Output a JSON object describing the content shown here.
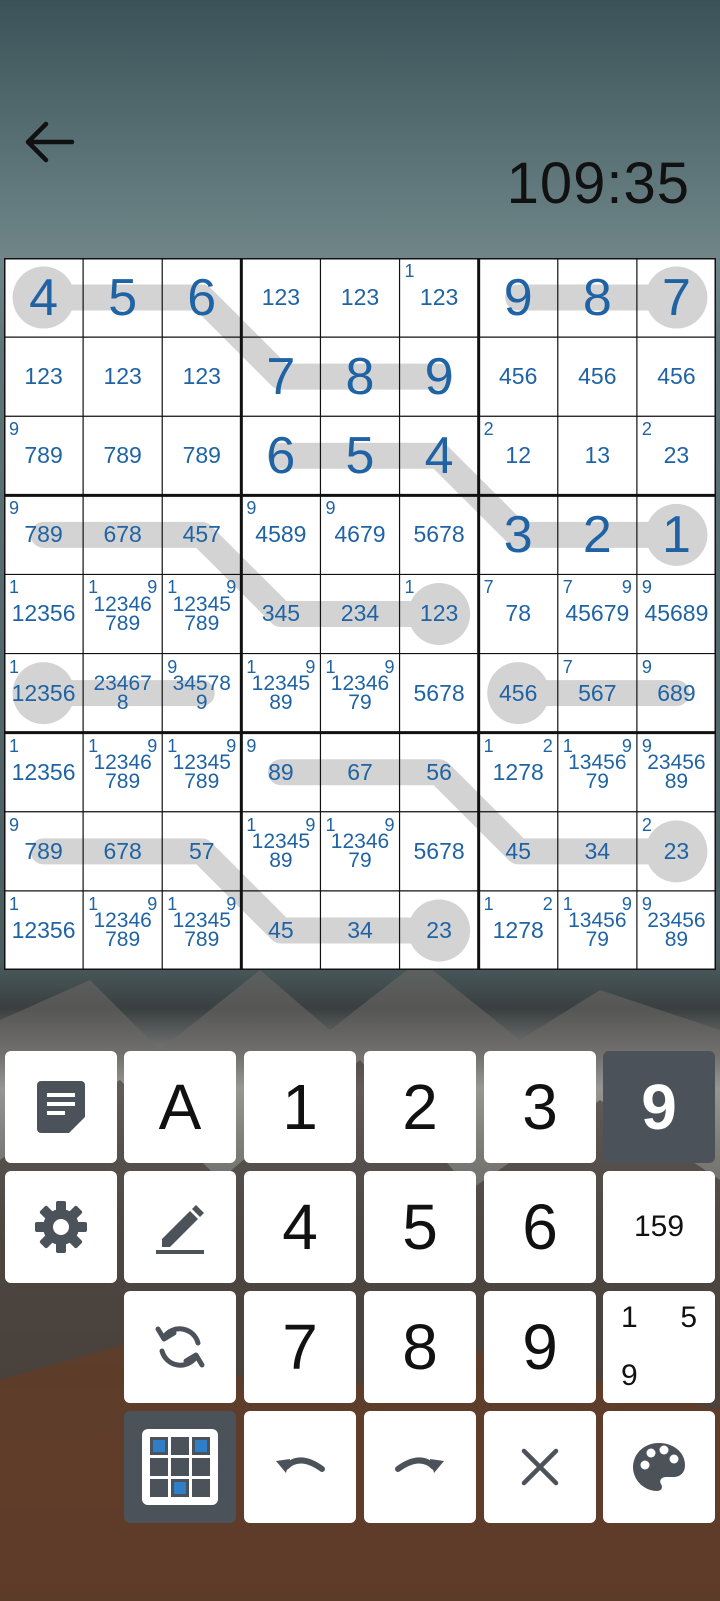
{
  "header": {
    "timer": "109:35",
    "back_icon": "arrow-left-icon"
  },
  "board": {
    "cells": [
      [
        {
          "v": "4"
        },
        {
          "v": "5"
        },
        {
          "v": "6"
        },
        {
          "c": "123"
        },
        {
          "c": "123"
        },
        {
          "c": "123",
          "tl": "1"
        },
        {
          "v": "9"
        },
        {
          "v": "8"
        },
        {
          "v": "7"
        }
      ],
      [
        {
          "c": "123"
        },
        {
          "c": "123"
        },
        {
          "c": "123"
        },
        {
          "v": "7"
        },
        {
          "v": "8"
        },
        {
          "v": "9"
        },
        {
          "c": "456"
        },
        {
          "c": "456"
        },
        {
          "c": "456"
        }
      ],
      [
        {
          "c": "789",
          "tl": "9"
        },
        {
          "c": "789"
        },
        {
          "c": "789"
        },
        {
          "v": "6"
        },
        {
          "v": "5"
        },
        {
          "v": "4"
        },
        {
          "c": "12",
          "tl": "2"
        },
        {
          "c": "13"
        },
        {
          "c": "23",
          "tl": "2"
        }
      ],
      [
        {
          "c": "789",
          "tl": "9"
        },
        {
          "c": "678"
        },
        {
          "c": "457"
        },
        {
          "c": "4589",
          "tl": "9"
        },
        {
          "c": "4679",
          "tl": "9"
        },
        {
          "c": "5678"
        },
        {
          "v": "3"
        },
        {
          "v": "2"
        },
        {
          "v": "1"
        }
      ],
      [
        {
          "c": "12356",
          "tl": "1"
        },
        {
          "c": "12346\n789",
          "tl": "1",
          "tr": "9"
        },
        {
          "c": "12345\n789",
          "tl": "1",
          "tr": "9"
        },
        {
          "c": "345"
        },
        {
          "c": "234"
        },
        {
          "c": "123",
          "tl": "1"
        },
        {
          "c": "78",
          "tl": "7"
        },
        {
          "c": "45679",
          "tl": "7",
          "tr": "9"
        },
        {
          "c": "45689",
          "tl": "9"
        }
      ],
      [
        {
          "c": "12356",
          "tl": "1"
        },
        {
          "c": "23467\n8"
        },
        {
          "c": "34578\n9",
          "tl": "9"
        },
        {
          "c": "12345\n89",
          "tl": "1",
          "tr": "9"
        },
        {
          "c": "12346\n79",
          "tl": "1",
          "tr": "9"
        },
        {
          "c": "5678"
        },
        {
          "c": "456"
        },
        {
          "c": "567",
          "tl": "7"
        },
        {
          "c": "689",
          "tl": "9"
        }
      ],
      [
        {
          "c": "12356",
          "tl": "1"
        },
        {
          "c": "12346\n789",
          "tl": "1",
          "tr": "9"
        },
        {
          "c": "12345\n789",
          "tl": "1",
          "tr": "9"
        },
        {
          "c": "89",
          "tl": "9"
        },
        {
          "c": "67"
        },
        {
          "c": "56"
        },
        {
          "c": "1278",
          "tl": "1",
          "tr": "2"
        },
        {
          "c": "13456\n79",
          "tl": "1",
          "tr": "9"
        },
        {
          "c": "23456\n89",
          "tl": "9"
        }
      ],
      [
        {
          "c": "789",
          "tl": "9"
        },
        {
          "c": "678"
        },
        {
          "c": "57"
        },
        {
          "c": "12345\n89",
          "tl": "1",
          "tr": "9"
        },
        {
          "c": "12346\n79",
          "tl": "1",
          "tr": "9"
        },
        {
          "c": "5678"
        },
        {
          "c": "45"
        },
        {
          "c": "34"
        },
        {
          "c": "23",
          "tl": "2"
        }
      ],
      [
        {
          "c": "12356",
          "tl": "1"
        },
        {
          "c": "12346\n789",
          "tl": "1",
          "tr": "9"
        },
        {
          "c": "12345\n789",
          "tl": "1",
          "tr": "9"
        },
        {
          "c": "45"
        },
        {
          "c": "34"
        },
        {
          "c": "23"
        },
        {
          "c": "1278",
          "tl": "1",
          "tr": "2"
        },
        {
          "c": "13456\n79",
          "tl": "1",
          "tr": "9"
        },
        {
          "c": "23456\n89",
          "tl": "9"
        }
      ]
    ]
  },
  "keypad": {
    "notes_icon": "note-icon",
    "auto_label": "A",
    "settings_icon": "gear-icon",
    "pencil_icon": "pencil-icon",
    "refresh_icon": "refresh-icon",
    "grid_icon": "grid-icon",
    "undo_icon": "undo-icon",
    "redo_icon": "redo-icon",
    "clear_icon": "close-icon",
    "palette_icon": "palette-icon",
    "digits": [
      "1",
      "2",
      "3",
      "4",
      "5",
      "6",
      "7",
      "8",
      "9"
    ],
    "selected_digit": "9",
    "combo_label": "159",
    "combo_corner": {
      "a": "1",
      "b": "5",
      "c": "9"
    }
  },
  "colors": {
    "digit": "#1f63a4",
    "line": "#d3d3d3",
    "dark_key": "#4c525a"
  }
}
